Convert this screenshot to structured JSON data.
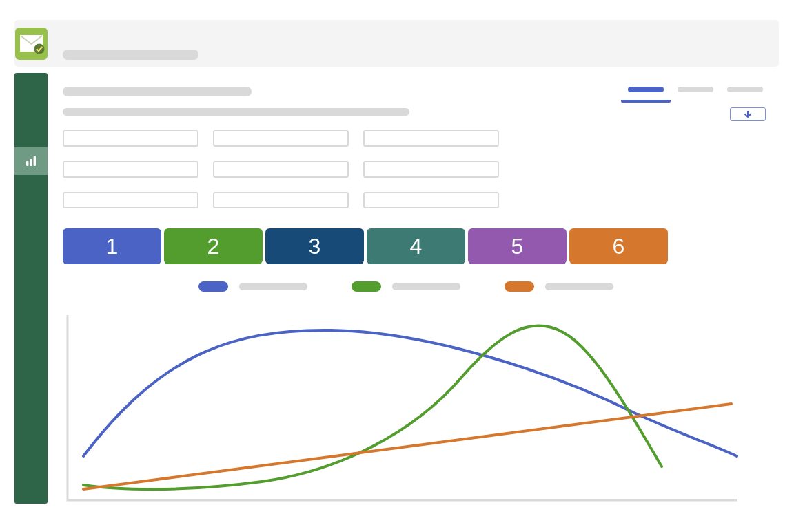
{
  "tabs": [
    {
      "selected": true
    },
    {
      "selected": false
    },
    {
      "selected": false
    }
  ],
  "sidebar": {
    "items": [
      {
        "selected": true
      }
    ]
  },
  "filter_fields": [
    {
      "kind": "input"
    },
    {
      "kind": "input"
    },
    {
      "kind": "input"
    },
    {
      "kind": "input"
    },
    {
      "kind": "input"
    },
    {
      "kind": "input"
    },
    {
      "kind": "input"
    },
    {
      "kind": "input"
    },
    {
      "kind": "input"
    }
  ],
  "tiles": [
    {
      "label": "1",
      "color": "#4a63c4"
    },
    {
      "label": "2",
      "color": "#529d2e"
    },
    {
      "label": "3",
      "color": "#184a78"
    },
    {
      "label": "4",
      "color": "#3c7a73"
    },
    {
      "label": "5",
      "color": "#9359af"
    },
    {
      "label": "6",
      "color": "#d5772d"
    }
  ],
  "legend": [
    {
      "color": "#4a63c4"
    },
    {
      "color": "#529d2e"
    },
    {
      "color": "#d5772d"
    }
  ]
}
